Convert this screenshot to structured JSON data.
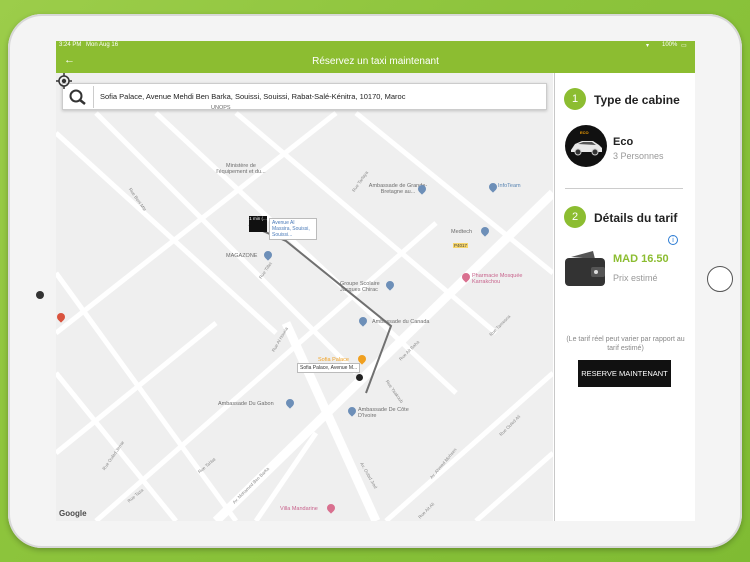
{
  "status": {
    "time": "3:24 PM",
    "date": "Mon Aug 16",
    "battery": "100%"
  },
  "header": {
    "title": "Réservez un taxi maintenant",
    "back_icon": "arrow-left-icon"
  },
  "search": {
    "value": "Sofia Palace, Avenue Mehdi Ben Barka, Souissi, Souissi, Rabat-Salé-Kénitra, 10170, Maroc"
  },
  "map": {
    "places": [
      {
        "name": "Ministère de l'équipement et du..."
      },
      {
        "name": "Ambassade de Grande-Bretagne au..."
      },
      {
        "name": "InfoTeam"
      },
      {
        "name": "Medtech"
      },
      {
        "name": "MAGAZONE"
      },
      {
        "name": "Groupe Scolaire Jacques Chirac"
      },
      {
        "name": "Ambassade du Canada"
      },
      {
        "name": "Pharmacie Mosquée Karrakchou"
      },
      {
        "name": "Ambassade Du Gabon"
      },
      {
        "name": "Ambassade De Côte D'Ivoire"
      },
      {
        "name": "Villa Mandarine"
      },
      {
        "name": "Sofia Palace"
      },
      {
        "name": "UNOPS"
      }
    ],
    "streets": [
      "Rue Beni Mtir",
      "Av. Mohamed Ben Barka",
      "Av. Oulad Jrad",
      "Rue Oulad Jerrar",
      "Rue Ait Ali",
      "Rue Ait Baha",
      "Rue Tamesna",
      "Rue Ouled Ali",
      "Rue Yaakoub",
      "Av. Ahmed Mohsen",
      "Rue Al Houria",
      "Rue Tiflet",
      "Rue Tahlat",
      "Rue Taza",
      "Rue Tarfaya",
      "P4017"
    ],
    "start_marker": {
      "label": "1\nmin (...",
      "address": "Avenue Al Massira, Souissi, Souissi..."
    },
    "end_marker": {
      "address": "Sofia Palace, Avenue M..."
    },
    "brand": "Google"
  },
  "panel": {
    "cabin": {
      "step": "1",
      "title": "Type de cabine",
      "name": "Eco",
      "capacity": "3 Personnes",
      "badge": "ECO"
    },
    "fare": {
      "step": "2",
      "title": "Détails du tarif",
      "price": "MAD 16.50",
      "price_label": "Prix estimé",
      "info_icon": "info-icon"
    },
    "note": "(Le tarif réel peut varier par rapport au tarif estimé)",
    "reserve_button": "RESERVE MAINTENANT"
  },
  "colors": {
    "accent": "#8cbd31",
    "button": "#111111"
  }
}
